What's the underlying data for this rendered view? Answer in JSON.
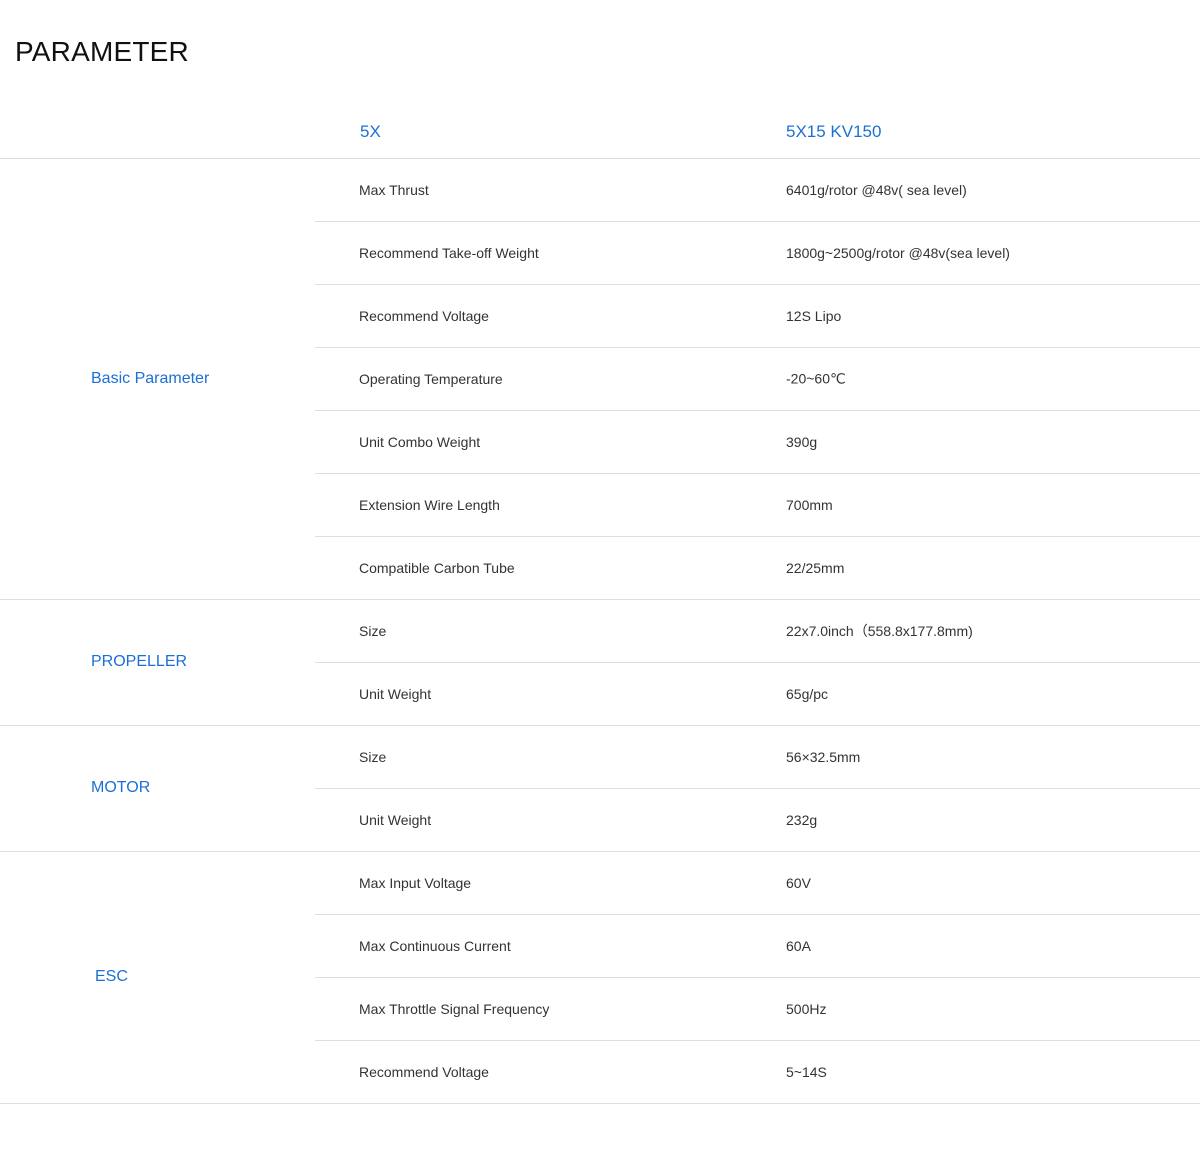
{
  "page_title": "PARAMETER",
  "header": {
    "series": "5X",
    "model": "5X15 KV150"
  },
  "groups": [
    {
      "name": "Basic Parameter",
      "rows": [
        {
          "label": "Max Thrust",
          "value": "6401g/rotor @48v( sea level)"
        },
        {
          "label": "Recommend Take-off Weight",
          "value": "1800g~2500g/rotor @48v(sea level)"
        },
        {
          "label": "Recommend Voltage",
          "value": "12S Lipo"
        },
        {
          "label": "Operating Temperature",
          "value": "-20~60℃"
        },
        {
          "label": "Unit Combo Weight",
          "value": "390g"
        },
        {
          "label": "Extension Wire Length",
          "value": "700mm"
        },
        {
          "label": "Compatible Carbon Tube",
          "value": "22/25mm"
        }
      ]
    },
    {
      "name": "PROPELLER",
      "rows": [
        {
          "label": "Size",
          "value": "22x7.0inch（558.8x177.8mm)"
        },
        {
          "label": "Unit Weight",
          "value": "65g/pc"
        }
      ]
    },
    {
      "name": "MOTOR",
      "rows": [
        {
          "label": "Size",
          "value": "56×32.5mm"
        },
        {
          "label": "Unit Weight",
          "value": "232g"
        }
      ]
    },
    {
      "name": "ESC",
      "rows": [
        {
          "label": "Max Input Voltage",
          "value": "60V"
        },
        {
          "label": "Max Continuous Current",
          "value": "60A"
        },
        {
          "label": "Max Throttle Signal Frequency",
          "value": "500Hz"
        },
        {
          "label": "Recommend Voltage",
          "value": "5~14S"
        }
      ]
    }
  ]
}
